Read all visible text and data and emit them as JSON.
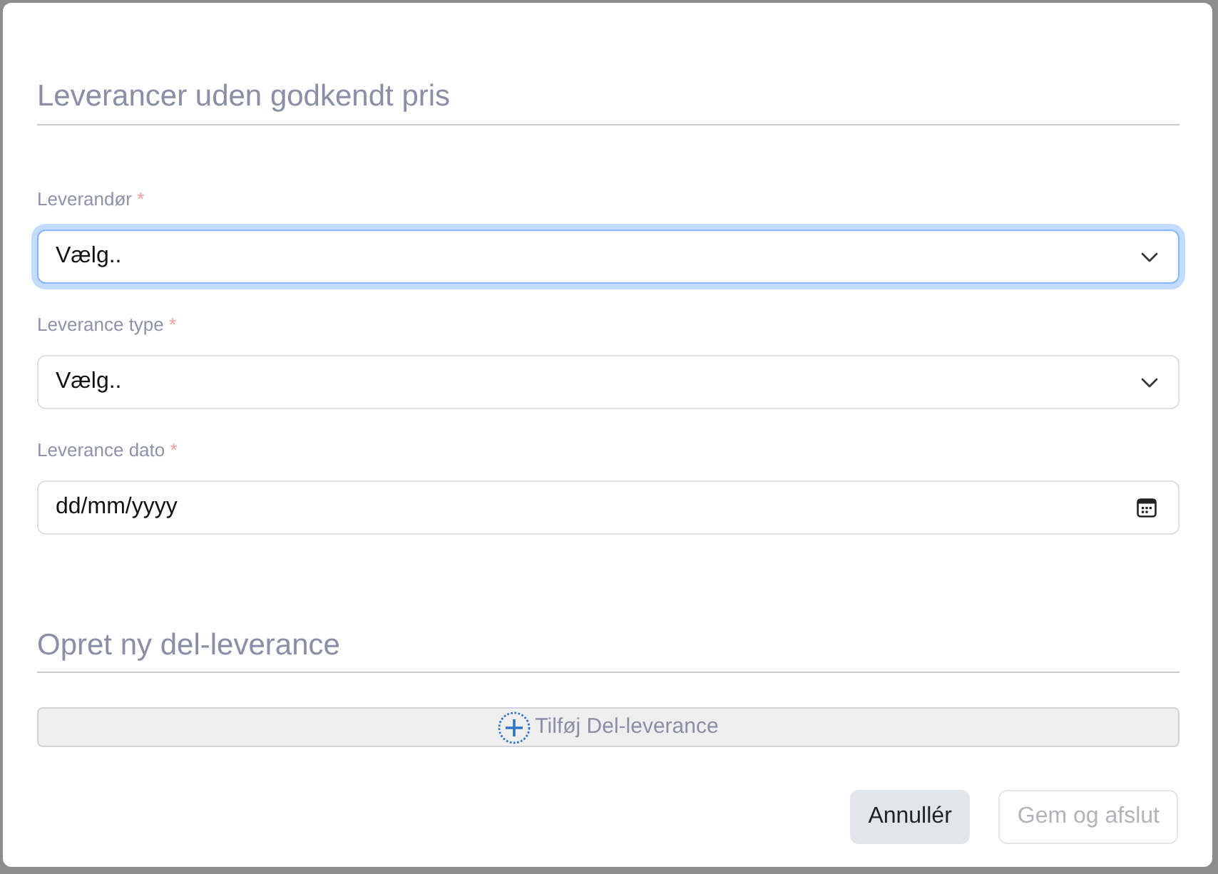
{
  "dialog": {
    "title": "Leverancer uden godkendt pris",
    "fields": [
      {
        "kind": "select",
        "label": "Leverandør",
        "required_mark": "*",
        "value": "Vælg..",
        "focused": true
      },
      {
        "kind": "select",
        "label": "Leverance type",
        "required_mark": "*",
        "value": "Vælg..",
        "focused": false
      },
      {
        "kind": "date",
        "label": "Leverance dato",
        "required_mark": "*",
        "placeholder": "dd/mm/yyyy",
        "focused": false
      }
    ],
    "section": {
      "title": "Opret ny del-leverance",
      "add_button": {
        "label": "Tilføj Del-leverance"
      }
    },
    "buttons": [
      {
        "label": "Annullér",
        "disabled": false
      },
      {
        "label": "Gem og afslut",
        "disabled": true
      }
    ]
  }
}
